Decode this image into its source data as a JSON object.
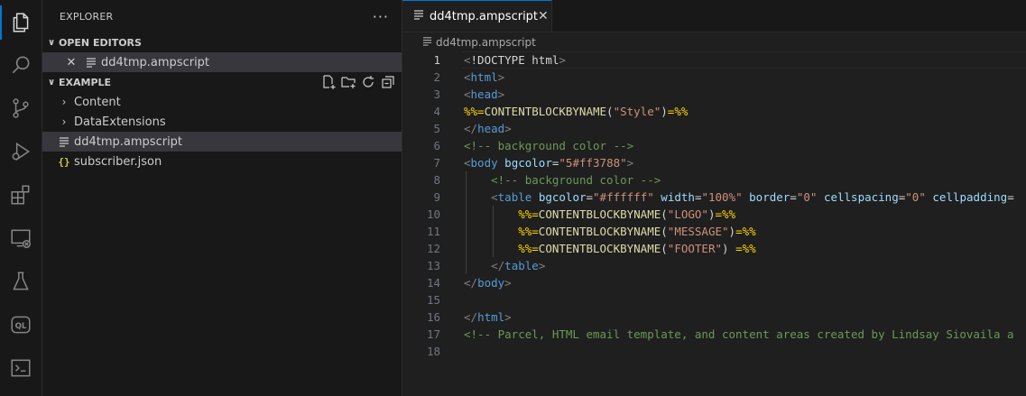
{
  "activity_bar": {
    "items": [
      {
        "name": "explorer-icon",
        "active": true
      },
      {
        "name": "search-icon"
      },
      {
        "name": "source-control-icon"
      },
      {
        "name": "run-debug-icon"
      },
      {
        "name": "extensions-icon"
      },
      {
        "name": "remote-explorer-icon"
      },
      {
        "name": "testing-icon"
      },
      {
        "name": "ql-icon",
        "label": "QL"
      },
      {
        "name": "terminal-icon"
      }
    ]
  },
  "sidebar": {
    "title": "EXPLORER",
    "more": "···",
    "open_editors": {
      "title": "OPEN EDITORS",
      "items": [
        {
          "label": "dd4tmp.ampscript"
        }
      ]
    },
    "folder": {
      "title": "EXAMPLE",
      "items": [
        {
          "label": "Content",
          "type": "folder"
        },
        {
          "label": "DataExtensions",
          "type": "folder"
        },
        {
          "label": "dd4tmp.ampscript",
          "type": "file",
          "selected": true
        },
        {
          "label": "subscriber.json",
          "type": "json",
          "json_icon": "{}"
        }
      ]
    }
  },
  "editor": {
    "tab": {
      "label": "dd4tmp.ampscript",
      "close": "✕"
    },
    "breadcrumb": "dd4tmp.ampscript",
    "current_line": 1,
    "lines": [
      [
        [
          "t-tag",
          "<"
        ],
        [
          "t-plain",
          "!DOCTYPE html"
        ],
        [
          "t-tag",
          ">"
        ]
      ],
      [
        [
          "t-tag",
          "<"
        ],
        [
          "t-name",
          "html"
        ],
        [
          "t-tag",
          ">"
        ]
      ],
      [
        [
          "t-tag",
          "<"
        ],
        [
          "t-name",
          "head"
        ],
        [
          "t-tag",
          ">"
        ]
      ],
      [
        [
          "t-del",
          "%%="
        ],
        [
          "t-amp",
          "CONTENTBLOCKBYNAME"
        ],
        [
          "t-plain",
          "("
        ],
        [
          "t-str",
          "\"Style\""
        ],
        [
          "t-plain",
          ")"
        ],
        [
          "t-del",
          "=%%"
        ]
      ],
      [
        [
          "t-tag",
          "</"
        ],
        [
          "t-name",
          "head"
        ],
        [
          "t-tag",
          ">"
        ]
      ],
      [
        [
          "t-com",
          "<!-- background color -->"
        ]
      ],
      [
        [
          "t-tag",
          "<"
        ],
        [
          "t-name",
          "body"
        ],
        [
          "t-plain",
          " "
        ],
        [
          "t-attr",
          "bgcolor"
        ],
        [
          "t-plain",
          "="
        ],
        [
          "t-str",
          "\"5#ff3788\""
        ],
        [
          "t-tag",
          ">"
        ]
      ],
      [
        [
          "t-plain",
          "    "
        ],
        [
          "t-com",
          "<!-- background color -->"
        ]
      ],
      [
        [
          "t-plain",
          "    "
        ],
        [
          "t-tag",
          "<"
        ],
        [
          "t-name",
          "table"
        ],
        [
          "t-plain",
          " "
        ],
        [
          "t-attr",
          "bgcolor"
        ],
        [
          "t-plain",
          "="
        ],
        [
          "t-str",
          "\"#ffffff\""
        ],
        [
          "t-plain",
          " "
        ],
        [
          "t-attr",
          "width"
        ],
        [
          "t-plain",
          "="
        ],
        [
          "t-str",
          "\"100%\""
        ],
        [
          "t-plain",
          " "
        ],
        [
          "t-attr",
          "border"
        ],
        [
          "t-plain",
          "="
        ],
        [
          "t-str",
          "\"0\""
        ],
        [
          "t-plain",
          " "
        ],
        [
          "t-attr",
          "cellspacing"
        ],
        [
          "t-plain",
          "="
        ],
        [
          "t-str",
          "\"0\""
        ],
        [
          "t-plain",
          " "
        ],
        [
          "t-attr",
          "cellpadding"
        ],
        [
          "t-plain",
          "="
        ]
      ],
      [
        [
          "t-plain",
          "        "
        ],
        [
          "t-del",
          "%%="
        ],
        [
          "t-amp",
          "CONTENTBLOCKBYNAME"
        ],
        [
          "t-plain",
          "("
        ],
        [
          "t-str",
          "\"LOGO\""
        ],
        [
          "t-plain",
          ")"
        ],
        [
          "t-del",
          "=%%"
        ]
      ],
      [
        [
          "t-plain",
          "        "
        ],
        [
          "t-del",
          "%%="
        ],
        [
          "t-amp",
          "CONTENTBLOCKBYNAME"
        ],
        [
          "t-plain",
          "("
        ],
        [
          "t-str",
          "\"MESSAGE\""
        ],
        [
          "t-plain",
          ")"
        ],
        [
          "t-del",
          "=%%"
        ]
      ],
      [
        [
          "t-plain",
          "        "
        ],
        [
          "t-del",
          "%%="
        ],
        [
          "t-amp",
          "CONTENTBLOCKBYNAME"
        ],
        [
          "t-plain",
          "("
        ],
        [
          "t-str",
          "\"FOOTER\""
        ],
        [
          "t-plain",
          ") "
        ],
        [
          "t-del",
          "=%%"
        ]
      ],
      [
        [
          "t-plain",
          "    "
        ],
        [
          "t-tag",
          "</"
        ],
        [
          "t-name",
          "table"
        ],
        [
          "t-tag",
          ">"
        ]
      ],
      [
        [
          "t-tag",
          "</"
        ],
        [
          "t-name",
          "body"
        ],
        [
          "t-tag",
          ">"
        ]
      ],
      [],
      [
        [
          "t-tag",
          "</"
        ],
        [
          "t-name",
          "html"
        ],
        [
          "t-tag",
          ">"
        ]
      ],
      [
        [
          "t-com",
          "<!-- Parcel, HTML email template, and content areas created by Lindsay Siovaila a"
        ]
      ],
      []
    ]
  }
}
